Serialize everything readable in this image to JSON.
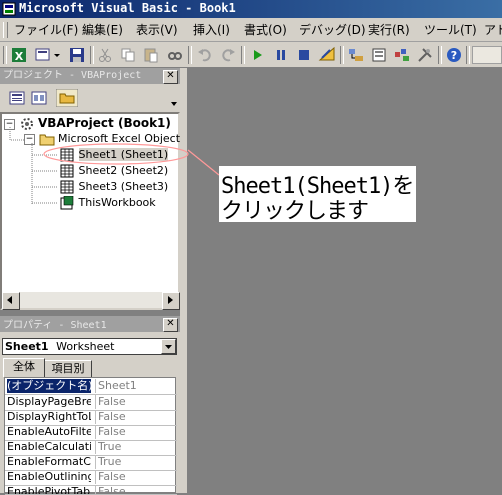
{
  "window": {
    "title": "Microsoft Visual Basic - Book1",
    "app_icon": "vba-app-icon"
  },
  "menubar": {
    "items": [
      "ファイル(F)",
      "編集(E)",
      "表示(V)",
      "挿入(I)",
      "書式(O)",
      "デバッグ(D)",
      "実行(R)",
      "ツール(T)",
      "アド"
    ]
  },
  "toolbar": {
    "icons": [
      "excel-view-icon",
      "insert-module-icon",
      "dropdown-arrow-icon",
      "save-icon",
      "cut-icon",
      "copy-icon",
      "paste-icon",
      "find-icon",
      "undo-icon",
      "redo-icon",
      "run-icon",
      "break-icon",
      "reset-icon",
      "design-mode-icon",
      "project-explorer-icon",
      "properties-icon",
      "object-browser-icon",
      "toolbox-icon",
      "help-icon"
    ]
  },
  "project": {
    "title": "プロジェクト - VBAProject",
    "tree": {
      "root": "VBAProject (Book1)",
      "folder": "Microsoft Excel Object",
      "items": [
        "Sheet1 (Sheet1)",
        "Sheet2 (Sheet2)",
        "Sheet3 (Sheet3)",
        "ThisWorkbook"
      ],
      "selected": "Sheet1 (Sheet1)"
    }
  },
  "properties": {
    "title": "プロパティ - Sheet1",
    "object_name": "Sheet1",
    "object_type": "Worksheet",
    "tabs": [
      "全体",
      "項目別"
    ],
    "rows": [
      {
        "name": "(オブジェクト名)",
        "value": "Sheet1"
      },
      {
        "name": "DisplayPageBrea",
        "value": "False"
      },
      {
        "name": "DisplayRightToLe",
        "value": "False"
      },
      {
        "name": "EnableAutoFilter",
        "value": "False"
      },
      {
        "name": "EnableCalculatio",
        "value": "True"
      },
      {
        "name": "EnableFormatCor",
        "value": "True"
      },
      {
        "name": "EnableOutlining",
        "value": "False"
      },
      {
        "name": "EnablePivotTable",
        "value": "False"
      }
    ]
  },
  "callout": {
    "line1": "Sheet1(Sheet1)を",
    "line2": "クリックします"
  },
  "colors": {
    "title_bar": "#0a246a",
    "chrome": "#d4d0c8",
    "workspace": "#808080",
    "highlight_ellipse": "#ff9999"
  }
}
